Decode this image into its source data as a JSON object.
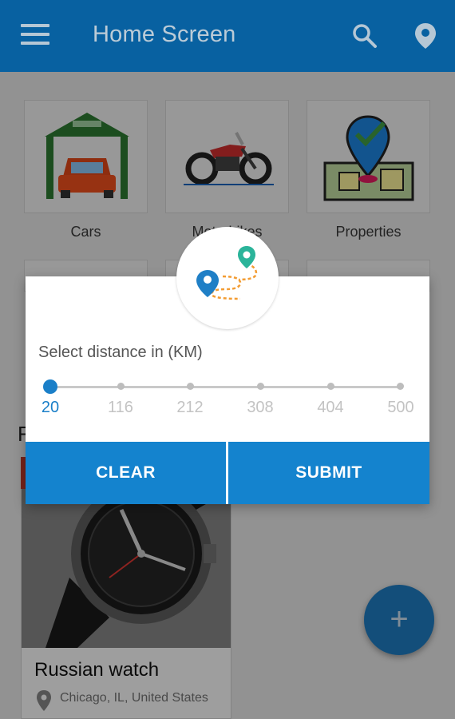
{
  "appbar": {
    "title": "Home Screen"
  },
  "categories": [
    {
      "label": "Cars"
    },
    {
      "label": "Motorbikes"
    },
    {
      "label": "Properties"
    }
  ],
  "section_heading": "F",
  "product": {
    "name": "Russian watch",
    "location": "Chicago, IL, United States"
  },
  "fab": {
    "symbol": "+"
  },
  "dialog": {
    "label": "Select distance in (KM)",
    "slider": {
      "value": 20,
      "ticks": [
        "20",
        "116",
        "212",
        "308",
        "404",
        "500"
      ]
    },
    "clear_label": "CLEAR",
    "submit_label": "SUBMIT"
  },
  "colors": {
    "primary": "#0a6fb8",
    "accent": "#1483ce",
    "pin_blue": "#1f7fc6",
    "pin_green": "#2bb49a",
    "route_orange": "#f39c32"
  }
}
